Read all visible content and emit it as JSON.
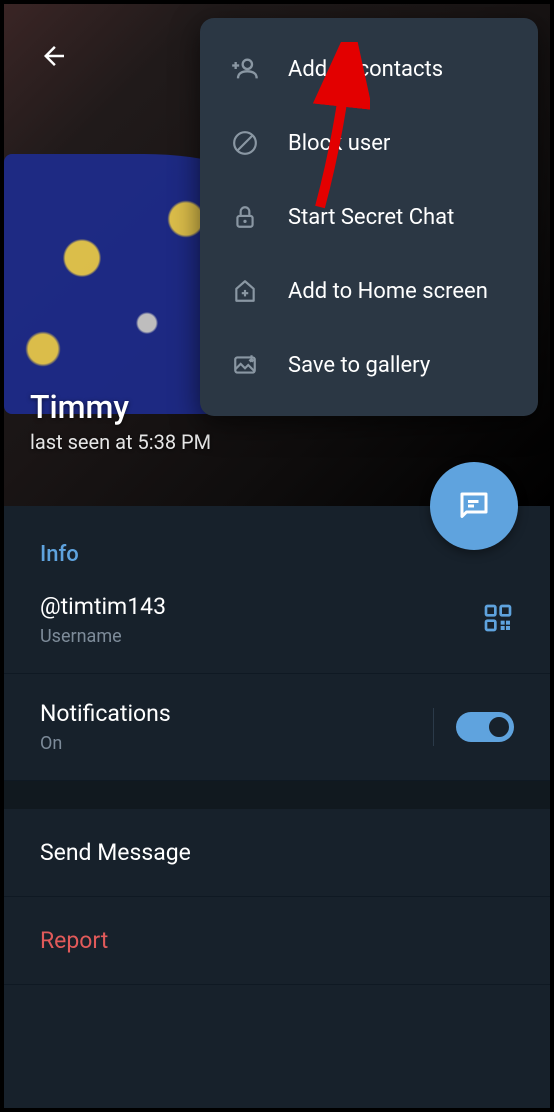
{
  "profile": {
    "name": "Timmy",
    "status": "last seen at 5:38 PM"
  },
  "menu": {
    "add_contacts": "Add to contacts",
    "block_user": "Block user",
    "secret_chat": "Start Secret Chat",
    "home_screen": "Add to Home screen",
    "save_gallery": "Save to gallery"
  },
  "info": {
    "section_title": "Info",
    "username": "@timtim143",
    "username_label": "Username",
    "notifications_label": "Notifications",
    "notifications_value": "On"
  },
  "actions": {
    "send_message": "Send Message",
    "report": "Report"
  }
}
